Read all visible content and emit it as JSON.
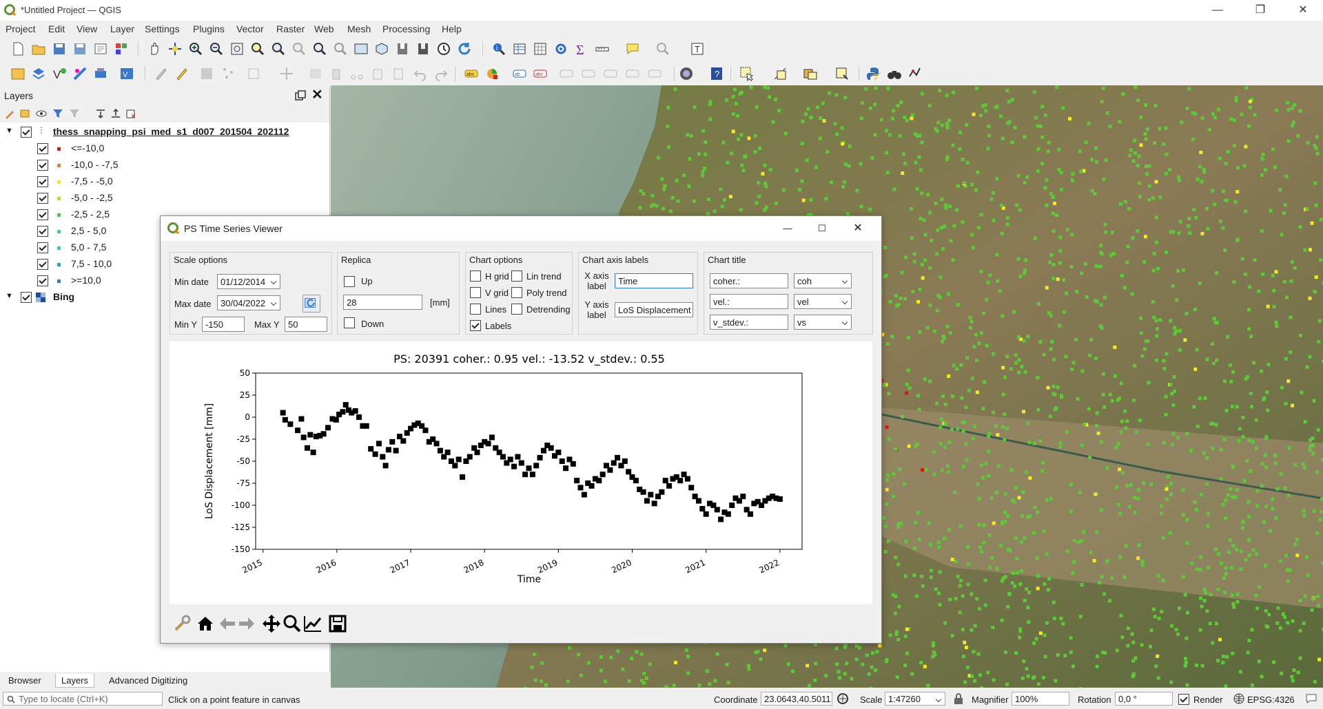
{
  "window": {
    "title": "*Untitled Project — QGIS"
  },
  "menu": [
    "Project",
    "Edit",
    "View",
    "Layer",
    "Settings",
    "Plugins",
    "Vector",
    "Raster",
    "Web",
    "Mesh",
    "Processing",
    "Help"
  ],
  "layers_panel": {
    "title": "Layers",
    "group": "thess_snapping_psi_med_s1_d007_201504_202112",
    "classes": [
      {
        "label": "<=-10,0",
        "color": "#d7191c"
      },
      {
        "label": "-10,0 - -7,5",
        "color": "#f07c3a"
      },
      {
        "label": "-7,5 - -5,0",
        "color": "#f5e628"
      },
      {
        "label": "-5,0 - -2,5",
        "color": "#b5e02f"
      },
      {
        "label": "-2,5 - 2,5",
        "color": "#4fc94a"
      },
      {
        "label": "2,5 - 5,0",
        "color": "#3ad1a3"
      },
      {
        "label": "5,0 - 7,5",
        "color": "#35c9d6"
      },
      {
        "label": "7,5 - 10,0",
        "color": "#2b9bd8"
      },
      {
        "label": ">=10,0",
        "color": "#2b83ba"
      }
    ],
    "basemap": "Bing",
    "tabs": [
      "Browser",
      "Layers",
      "Advanced Digitizing"
    ]
  },
  "dialog": {
    "title": "PS Time Series Viewer",
    "scale": {
      "title": "Scale options",
      "min_date_label": "Min date",
      "min_date": "01/12/2014",
      "max_date_label": "Max date",
      "max_date": "30/04/2022",
      "min_y_label": "Min Y",
      "min_y": "-150",
      "max_y_label": "Max Y",
      "max_y": "50"
    },
    "replica": {
      "title": "Replica",
      "up": "Up",
      "value": "28",
      "unit": "[mm]",
      "down": "Down"
    },
    "chart_options": {
      "title": "Chart options",
      "hgrid": "H grid",
      "vgrid": "V grid",
      "lines": "Lines",
      "labels": "Labels",
      "lin_trend": "Lin trend",
      "poly_trend": "Poly trend",
      "detrending": "Detrending"
    },
    "axis_labels": {
      "title": "Chart axis labels",
      "x_label": "X axis\nlabel",
      "x_value": "Time",
      "y_label": "Y axis\nlabel",
      "y_value": "LoS Displacement ["
    },
    "chart_title": {
      "title": "Chart title",
      "f1": "coher.:",
      "c1": "coh",
      "f2": "vel.:",
      "c2": "vel",
      "f3": "v_stdev.:",
      "c3": "vs"
    }
  },
  "chart_data": {
    "type": "scatter",
    "title": "PS: 20391 coher.: 0.95 vel.: -13.52 v_stdev.: 0.55",
    "xlabel": "Time",
    "ylabel": "LoS Displacement [mm]",
    "xlim": [
      2014.9,
      2022.3
    ],
    "ylim": [
      -150,
      50
    ],
    "xticks": [
      "2015",
      "2016",
      "2017",
      "2018",
      "2019",
      "2020",
      "2021",
      "2022"
    ],
    "yticks": [
      50,
      25,
      0,
      -25,
      -50,
      -75,
      -100,
      -125,
      -150
    ],
    "grid": false,
    "x": [
      2015.27,
      2015.3,
      2015.37,
      2015.47,
      2015.52,
      2015.55,
      2015.6,
      2015.64,
      2015.68,
      2015.72,
      2015.77,
      2015.82,
      2015.88,
      2015.94,
      2015.99,
      2016.03,
      2016.08,
      2016.12,
      2016.16,
      2016.2,
      2016.25,
      2016.3,
      2016.35,
      2016.4,
      2016.46,
      2016.52,
      2016.57,
      2016.62,
      2016.66,
      2016.7,
      2016.75,
      2016.8,
      2016.85,
      2016.9,
      2016.95,
      2017.0,
      2017.05,
      2017.1,
      2017.15,
      2017.2,
      2017.25,
      2017.3,
      2017.35,
      2017.4,
      2017.45,
      2017.5,
      2017.55,
      2017.6,
      2017.65,
      2017.7,
      2017.75,
      2017.8,
      2017.86,
      2017.9,
      2017.95,
      2018.0,
      2018.05,
      2018.1,
      2018.15,
      2018.2,
      2018.25,
      2018.3,
      2018.35,
      2018.4,
      2018.45,
      2018.5,
      2018.55,
      2018.6,
      2018.65,
      2018.7,
      2018.75,
      2018.8,
      2018.85,
      2018.9,
      2018.95,
      2019.0,
      2019.05,
      2019.1,
      2019.15,
      2019.2,
      2019.25,
      2019.3,
      2019.35,
      2019.4,
      2019.45,
      2019.5,
      2019.55,
      2019.6,
      2019.65,
      2019.7,
      2019.75,
      2019.8,
      2019.85,
      2019.9,
      2019.95,
      2020.0,
      2020.05,
      2020.1,
      2020.15,
      2020.2,
      2020.25,
      2020.3,
      2020.35,
      2020.4,
      2020.45,
      2020.5,
      2020.55,
      2020.6,
      2020.65,
      2020.7,
      2020.75,
      2020.8,
      2020.85,
      2020.9,
      2020.95,
      2021.0,
      2021.05,
      2021.1,
      2021.15,
      2021.2,
      2021.25,
      2021.3,
      2021.35,
      2021.4,
      2021.45,
      2021.5,
      2021.55,
      2021.6,
      2021.65,
      2021.7,
      2021.75,
      2021.8,
      2021.85,
      2021.9,
      2021.95,
      2022.0
    ],
    "y": [
      5,
      -3,
      -8,
      -15,
      -2,
      -23,
      -35,
      -20,
      -40,
      -22,
      -21,
      -19,
      -12,
      -2,
      -3,
      3,
      6,
      14,
      8,
      5,
      7,
      0,
      -10,
      -10,
      -36,
      -42,
      -30,
      -45,
      -55,
      -37,
      -28,
      -38,
      -22,
      -27,
      -18,
      -13,
      -9,
      -7,
      -10,
      -15,
      -28,
      -25,
      -30,
      -38,
      -45,
      -40,
      -50,
      -55,
      -48,
      -68,
      -50,
      -45,
      -35,
      -40,
      -32,
      -28,
      -30,
      -23,
      -35,
      -40,
      -45,
      -52,
      -48,
      -56,
      -45,
      -52,
      -65,
      -58,
      -65,
      -55,
      -46,
      -38,
      -32,
      -35,
      -44,
      -40,
      -50,
      -58,
      -48,
      -53,
      -72,
      -80,
      -88,
      -75,
      -78,
      -70,
      -72,
      -65,
      -55,
      -60,
      -52,
      -46,
      -55,
      -50,
      -62,
      -68,
      -72,
      -82,
      -85,
      -95,
      -88,
      -98,
      -90,
      -85,
      -72,
      -78,
      -70,
      -68,
      -72,
      -65,
      -70,
      -80,
      -90,
      -95,
      -104,
      -110,
      -98,
      -100,
      -105,
      -116,
      -108,
      -110,
      -100,
      -92,
      -95,
      -90,
      -105,
      -110,
      -98,
      -96,
      -100,
      -95,
      -92,
      -90,
      -92,
      -93
    ],
    "marker_color": "#000000"
  },
  "chart_tools": [
    "settings-icon",
    "home-icon",
    "back-icon",
    "forward-icon",
    "pan-icon",
    "zoom-icon",
    "subplots-icon",
    "save-icon"
  ],
  "status": {
    "locate_placeholder": "Type to locate (Ctrl+K)",
    "message": "Click on a point feature in canvas",
    "coordinate_label": "Coordinate",
    "coordinate": "23.0643,40.5011",
    "scale_label": "Scale",
    "scale": "1:47260",
    "magnifier_label": "Magnifier",
    "magnifier": "100%",
    "rotation_label": "Rotation",
    "rotation": "0,0 °",
    "render_label": "Render",
    "crs": "EPSG:4326"
  },
  "colors": {
    "accent": "#4f9d2f",
    "ps_green": "#5ec83a",
    "ps_yellow": "#f3e82b",
    "ps_red": "#d7191c"
  }
}
